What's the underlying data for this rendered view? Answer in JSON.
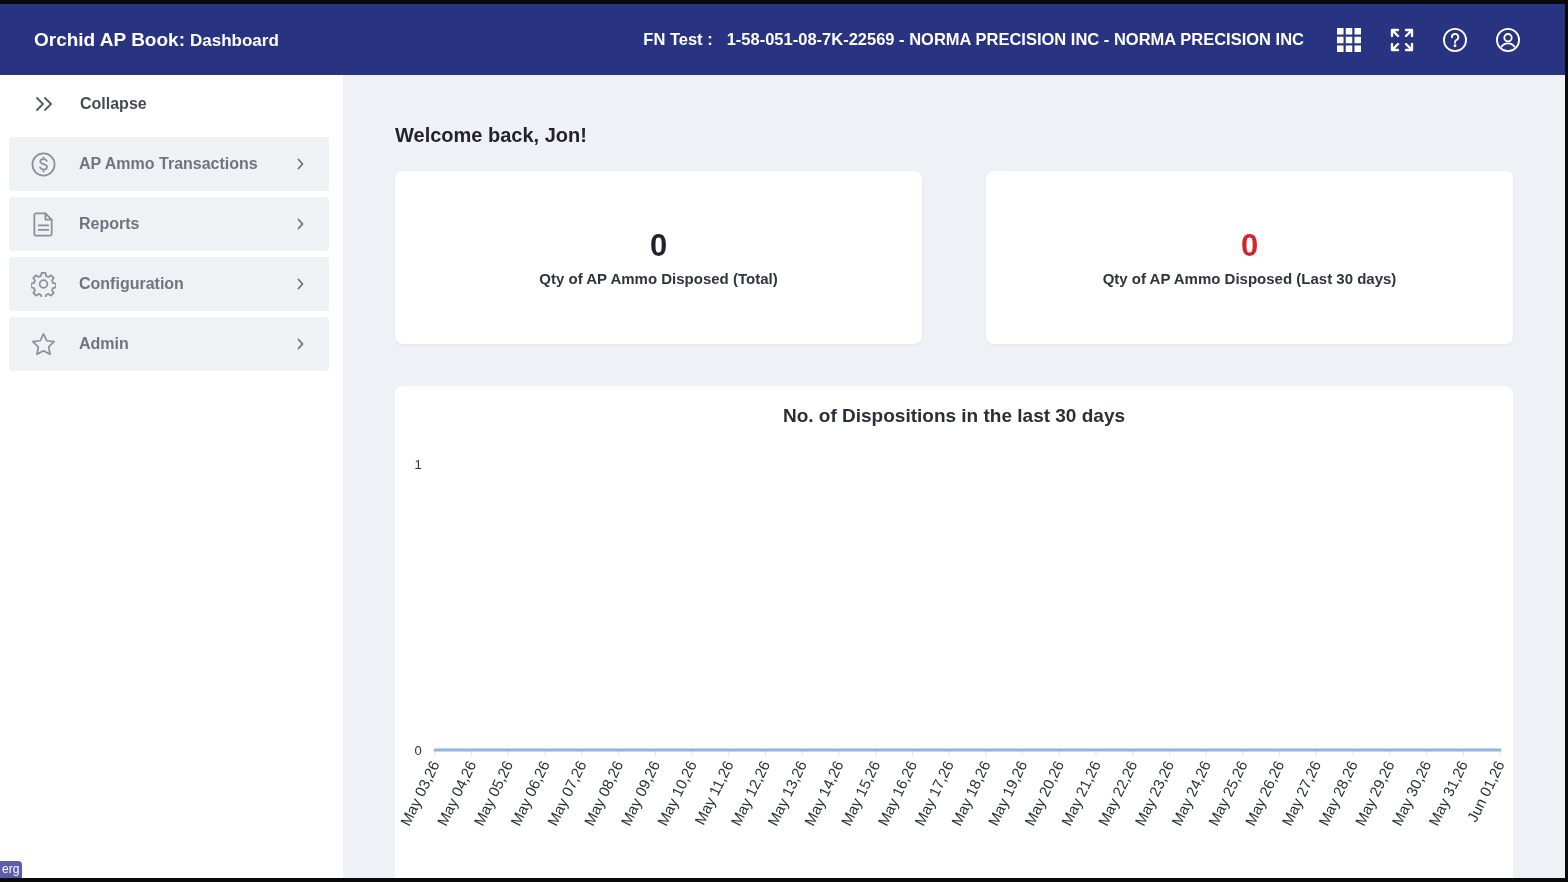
{
  "header": {
    "app_title": "Orchid AP Book:",
    "page_title": "Dashboard",
    "context_label": "FN Test :",
    "context_value": "1-58-051-08-7K-22569 - NORMA PRECISION INC - NORMA PRECISION INC"
  },
  "sidebar": {
    "collapse_label": "Collapse",
    "items": [
      {
        "label": "AP Ammo Transactions"
      },
      {
        "label": "Reports"
      },
      {
        "label": "Configuration"
      },
      {
        "label": "Admin"
      }
    ]
  },
  "welcome": "Welcome back, Jon!",
  "stats": [
    {
      "value": "0",
      "label": "Qty of AP Ammo Disposed (Total)",
      "color": "#1f232b"
    },
    {
      "value": "0",
      "label": "Qty of AP Ammo Disposed (Last 30 days)",
      "color": "#d3262c"
    }
  ],
  "chart_panel": {
    "chart_data": {
      "type": "line",
      "title": "No. of Dispositions in the last 30 days",
      "categories": [
        "May 03,26",
        "May 04,26",
        "May 05,26",
        "May 06,26",
        "May 07,26",
        "May 08,26",
        "May 09,26",
        "May 10,26",
        "May 11,26",
        "May 12,26",
        "May 13,26",
        "May 14,26",
        "May 15,26",
        "May 16,26",
        "May 17,26",
        "May 18,26",
        "May 19,26",
        "May 20,26",
        "May 21,26",
        "May 22,26",
        "May 23,26",
        "May 24,26",
        "May 25,26",
        "May 26,26",
        "May 27,26",
        "May 28,26",
        "May 29,26",
        "May 30,26",
        "May 31,26",
        "Jun 01,26"
      ],
      "series": [
        {
          "color": "#8db4e2",
          "values": [
            0,
            0,
            0,
            0,
            0,
            0,
            0,
            0,
            0,
            0,
            0,
            0,
            0,
            0,
            0,
            0,
            0,
            0,
            0,
            0,
            0,
            0,
            0,
            0,
            0,
            0,
            0,
            0,
            0,
            0
          ]
        }
      ],
      "ylim": [
        0,
        1
      ],
      "yticks": [
        0,
        1
      ]
    }
  },
  "corner_tag": {
    "label": "erg"
  }
}
